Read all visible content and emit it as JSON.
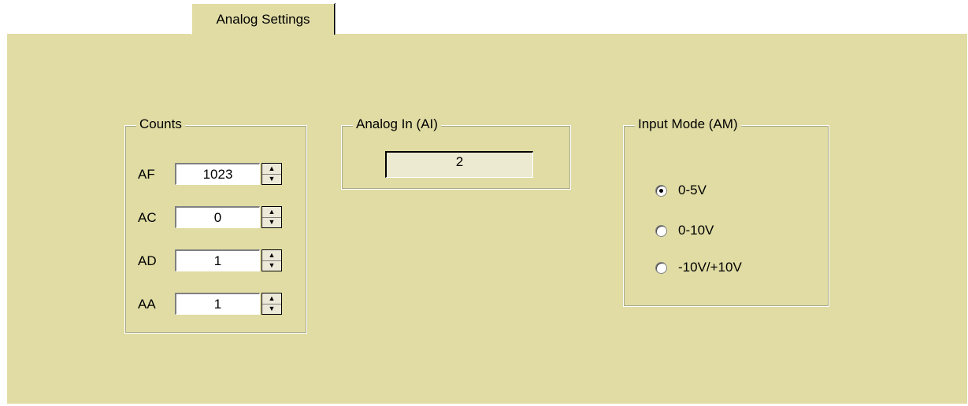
{
  "tab": {
    "label": "Analog Settings"
  },
  "counts": {
    "title": "Counts",
    "rows": [
      {
        "label": "AF",
        "value": "1023"
      },
      {
        "label": "AC",
        "value": "0"
      },
      {
        "label": "AD",
        "value": "1"
      },
      {
        "label": "AA",
        "value": "1"
      }
    ],
    "spin_up": "▲",
    "spin_down": "▼"
  },
  "analog_in": {
    "title": "Analog In (AI)",
    "value": "2"
  },
  "input_mode": {
    "title": "Input Mode (AM)",
    "options": [
      {
        "label": "0-5V",
        "checked": true
      },
      {
        "label": "0-10V",
        "checked": false
      },
      {
        "label": "-10V/+10V",
        "checked": false
      }
    ]
  },
  "colors": {
    "panel": "#e0dca4",
    "readout": "#ecead0"
  }
}
